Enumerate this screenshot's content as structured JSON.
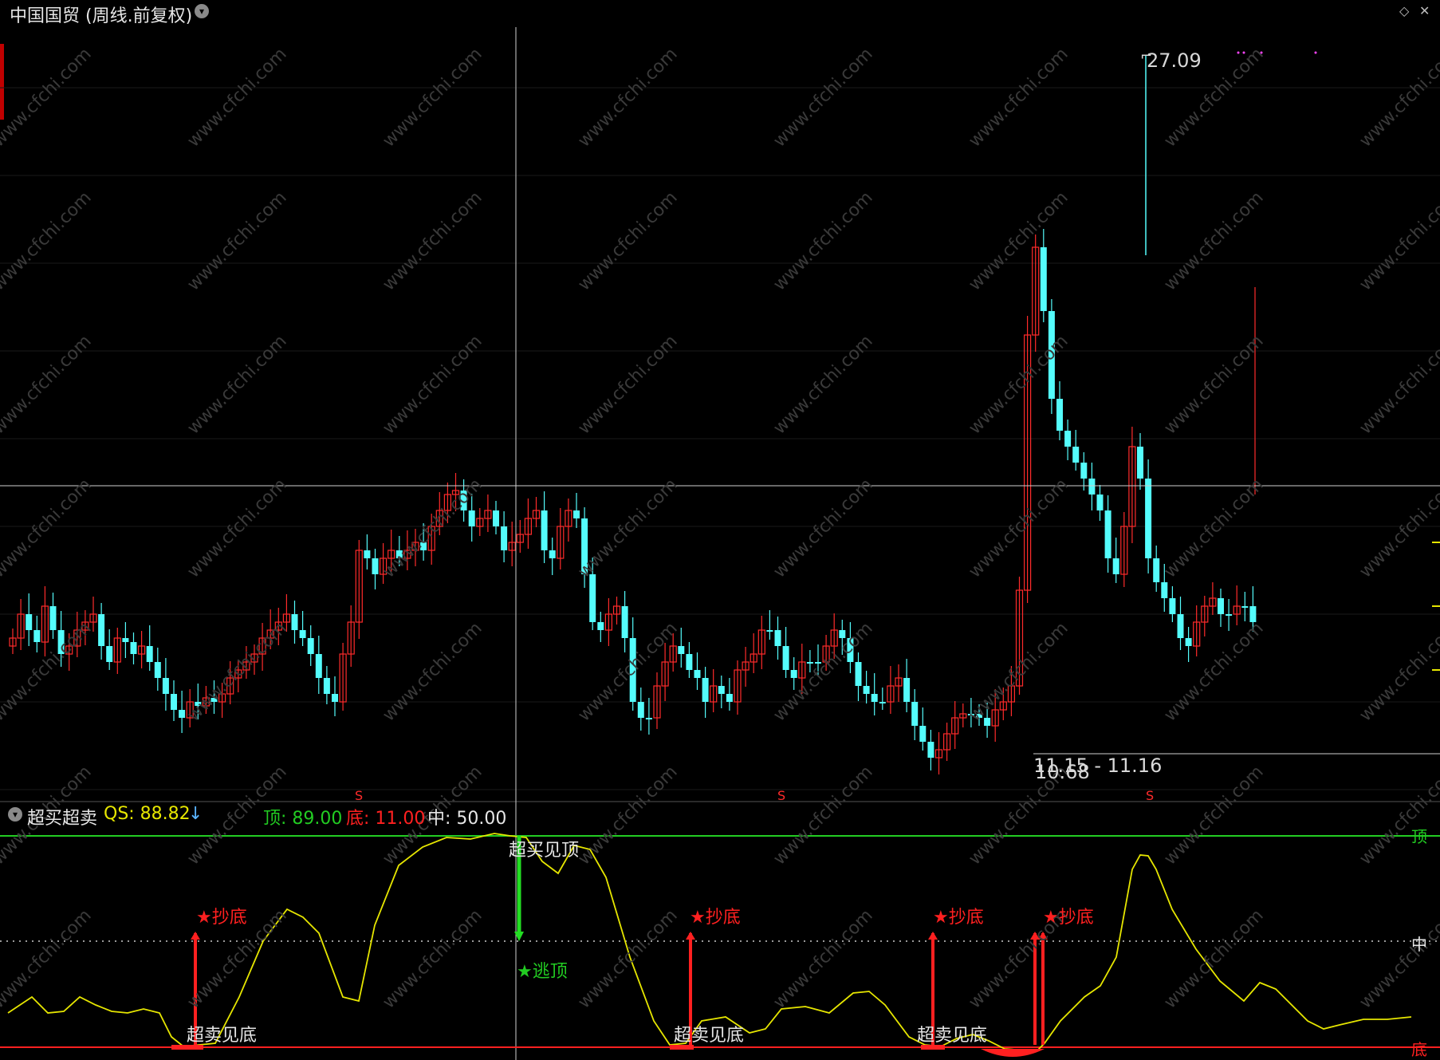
{
  "header": {
    "title": "中国国贸 (周线.前复权)",
    "chevron_icon": "chevron-down-icon",
    "window_icons": [
      "diamond-icon",
      "close-icon"
    ]
  },
  "price_chart": {
    "high_label": "27.09",
    "low_label": "10.68",
    "range_label": "11.15 - 11.16",
    "s_markers": [
      "S",
      "S",
      "S"
    ],
    "colors": {
      "up": "#ff2b2b",
      "down": "#54fcfc",
      "crosshair": "#cfcfcf",
      "background": "#000000"
    }
  },
  "indicator": {
    "name": "超买超卖",
    "qs_label": "QS: 88.82",
    "qs_arrow": "↓",
    "top_label": "顶: 89.00",
    "bottom_label": "底: 11.00",
    "mid_label": "中: 50.00",
    "right_top": "顶",
    "right_mid": "中",
    "right_bottom": "底",
    "signals": {
      "overbought": "超买见顶",
      "oversold": "超卖见底",
      "buy": "★抄底",
      "escape": "★逃顶"
    },
    "colors": {
      "line": "#e6e600",
      "top": "#22cc22",
      "bottom": "#ff2020",
      "mid": "#cccccc"
    }
  },
  "watermark": "www.cfchi.com"
}
